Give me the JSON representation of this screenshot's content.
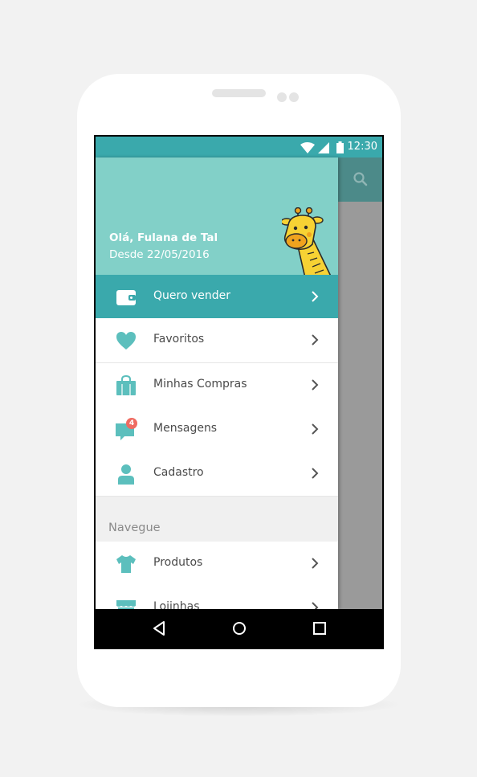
{
  "status_bar": {
    "time": "12:30"
  },
  "drawer": {
    "header": {
      "greeting": "Olá, Fulana de Tal",
      "member_since": "Desde 22/05/2016",
      "mascot": "giraffe"
    },
    "items": [
      {
        "label": "Quero vender",
        "icon": "wallet-icon",
        "active": true
      },
      {
        "label": "Favoritos",
        "icon": "heart-icon",
        "active": false
      },
      {
        "label": "Minhas Compras",
        "icon": "shopping-bag-icon",
        "active": false
      },
      {
        "label": "Mensagens",
        "icon": "chat-icon",
        "active": false,
        "badge": "4"
      },
      {
        "label": "Cadastro",
        "icon": "user-icon",
        "active": false
      }
    ],
    "section_title": "Navegue",
    "browse_items": [
      {
        "label": "Produtos",
        "icon": "shirt-icon"
      },
      {
        "label": "Lojinhas",
        "icon": "store-icon"
      }
    ]
  },
  "colors": {
    "primary": "#3aa9ac",
    "header": "#82d0c8",
    "badge": "#ef6b61",
    "icon": "#5cbfbd",
    "toolbar_dimmed": "#4c8a89"
  }
}
